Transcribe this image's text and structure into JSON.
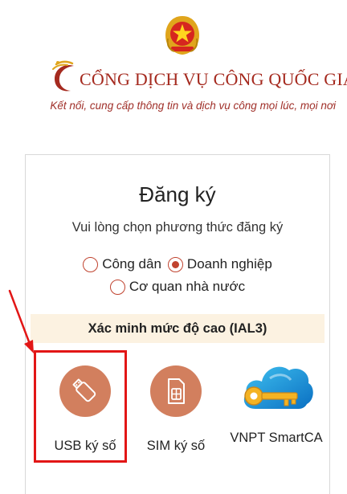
{
  "header": {
    "title": "CỔNG DỊCH VỤ CÔNG QUỐC GIA",
    "tagline": "Kết nối, cung cấp thông tin và dịch vụ công mọi lúc, mọi nơi"
  },
  "register": {
    "title": "Đăng ký",
    "subtitle": "Vui lòng chọn phương thức đăng ký",
    "options": [
      {
        "label": "Công dân",
        "checked": false
      },
      {
        "label": "Doanh nghiệp",
        "checked": true
      },
      {
        "label": "Cơ quan nhà nước",
        "checked": false
      }
    ],
    "level_label": "Xác minh mức độ cao (IAL3)",
    "methods": [
      {
        "label": "USB ký số",
        "icon": "usb-icon"
      },
      {
        "label": "SIM ký số",
        "icon": "sim-card-icon"
      },
      {
        "label": "VNPT SmartCA",
        "icon": "vnpt-smartca-logo"
      }
    ]
  },
  "colors": {
    "brand_red": "#a52a1f",
    "accent": "#c0432f",
    "method_circle": "#d27f5e",
    "band": "#fcf2e1",
    "highlight": "#e21616"
  }
}
